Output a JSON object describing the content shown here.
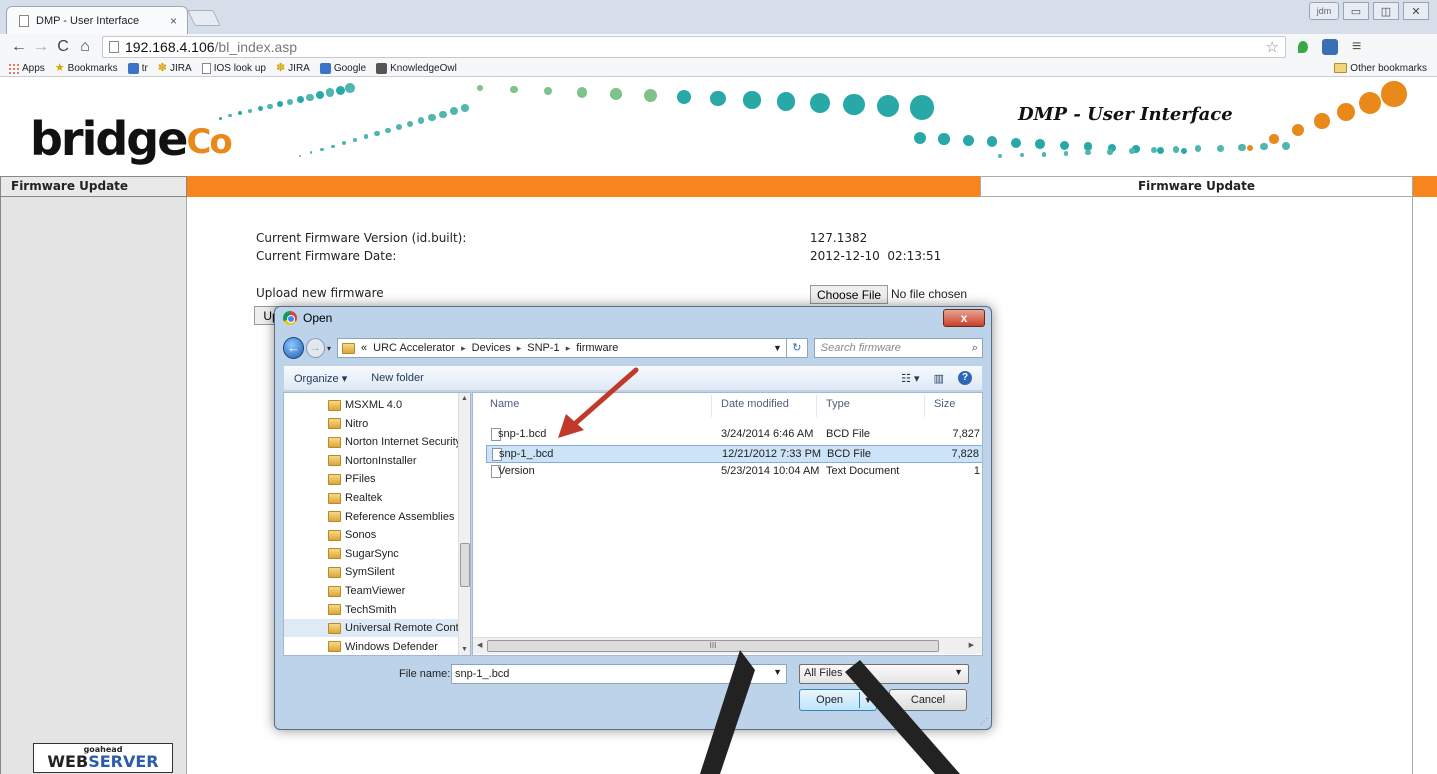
{
  "browser": {
    "tab_title": "DMP - User Interface",
    "tab_close": "×",
    "user_label": "jdm",
    "window_controls": [
      "▭",
      "◫",
      "✕"
    ],
    "url_host": "192.168.4.106",
    "url_path": "/bl_index.asp",
    "bookmarks": [
      "Apps",
      "Bookmarks",
      "tr",
      "JIRA",
      "IOS look up",
      "JIRA",
      "Google",
      "KnowledgeOwl"
    ],
    "other_bookmarks": "Other bookmarks",
    "icons": [
      "back-icon",
      "forward-icon",
      "reload-icon",
      "home-icon",
      "star-icon",
      "menu-icon"
    ]
  },
  "page": {
    "logo_text": "bridge",
    "logo_co": "Co",
    "title": "DMP - User Interface",
    "left_header": "Firmware Update",
    "right_header": "Firmware Update",
    "firmware_version_label": "Current Firmware Version (id.built):",
    "firmware_version_value": "127.1382",
    "firmware_date_label": "Current Firmware Date:",
    "firmware_date_value": "2012-12-10  02:13:51",
    "upload_label": "Upload new firmware",
    "choose_file": "Choose File",
    "no_file": "No file chosen",
    "upload_button": "Up",
    "webserver_small": "goahead",
    "webserver_web": "WEB",
    "webserver_server": "SERVER"
  },
  "dialog": {
    "title": "Open",
    "close": "x",
    "breadcrumb": [
      "«",
      "URC Accelerator",
      "Devices",
      "SNP-1",
      "firmware"
    ],
    "search_placeholder": "Search firmware",
    "organize": "Organize ▾",
    "new_folder": "New folder",
    "tree": [
      "MSXML 4.0",
      "Nitro",
      "Norton Internet Security",
      "NortonInstaller",
      "PFiles",
      "Realtek",
      "Reference Assemblies",
      "Sonos",
      "SugarSync",
      "SymSilent",
      "TeamViewer",
      "TechSmith",
      "Universal Remote Contr",
      "Windows Defender"
    ],
    "selected_tree_index": 12,
    "columns": [
      "Name",
      "Date modified",
      "Type",
      "Size"
    ],
    "files": [
      {
        "name": "snp-1.bcd",
        "date": "3/24/2014 6:46 AM",
        "type": "BCD File",
        "size": "7,827"
      },
      {
        "name": "snp-1_.bcd",
        "date": "12/21/2012 7:33 PM",
        "type": "BCD File",
        "size": "7,828"
      },
      {
        "name": "Version",
        "date": "5/23/2014 10:04 AM",
        "type": "Text Document",
        "size": "1"
      }
    ],
    "selected_file_index": 1,
    "scroll_label": "III",
    "file_name_label": "File name:",
    "file_name_value": "snp-1_.bcd",
    "filter": "All Files",
    "open": "Open",
    "cancel": "Cancel"
  },
  "colors": {
    "accent_orange": "#f7841c",
    "arrow_red": "#c0392b",
    "dots": [
      "#29a8a8",
      "#4fb6b0",
      "#7fc28a",
      "#e9891a"
    ]
  }
}
